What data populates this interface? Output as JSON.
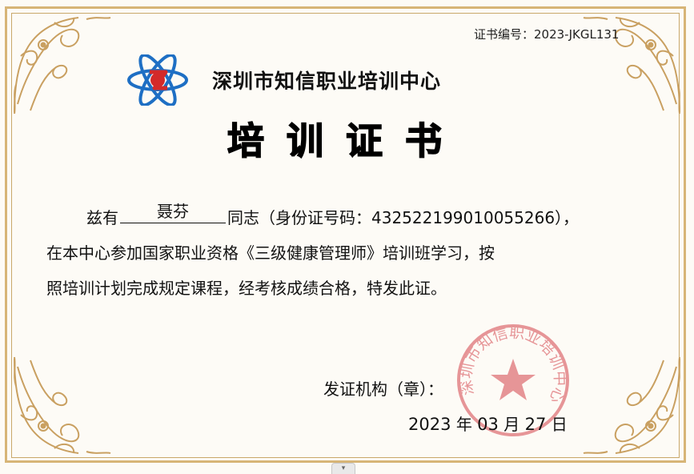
{
  "certificate_number": "证书编号：2023-JKGL131",
  "organization": "深圳市知信职业培训中心",
  "title": "培训证书",
  "body": {
    "prefix": "兹有",
    "name": "聂芬",
    "after_name": "同志（身份证号码：",
    "id_number": "432522199010055266",
    "id_close": "），",
    "line2": "在本中心参加国家职业资格《三级健康管理师》培训班学习，按",
    "line3": "照培训计划完成规定课程，经考核成绩合格，特发此证。"
  },
  "issuer_label": "发证机构（章）：",
  "date": {
    "year": "2023",
    "year_unit": "年",
    "month": "03",
    "month_unit": "月",
    "day": "27",
    "day_unit": "日"
  },
  "seal": {
    "text": "深圳市知信职业培训中心",
    "color": "#d4424a"
  },
  "colors": {
    "border_gold": "#d7b577",
    "logo_blue": "#1e6fc4",
    "logo_red": "#d32a2a"
  },
  "icons": [
    "atom-logo-icon",
    "corner-ornament-icon",
    "official-seal-star-icon",
    "expand-handle-icon"
  ],
  "handle_glyph": "▾"
}
